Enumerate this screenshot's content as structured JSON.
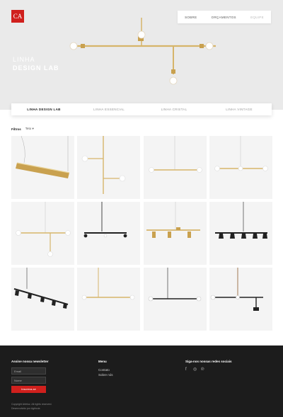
{
  "brand": {
    "logo_text": "CA",
    "accent": "#d0201d"
  },
  "nav": {
    "items": [
      "Sobre",
      "Orçamentos",
      "Equipe"
    ]
  },
  "hero": {
    "title_line1": "LINHA",
    "title_line2": "DESIGN LAB"
  },
  "tabs": [
    {
      "label": "Linha Design Lab",
      "active": true
    },
    {
      "label": "Linha Essencial",
      "active": false
    },
    {
      "label": "Linha Cristal",
      "active": false
    },
    {
      "label": "Linha Vintage",
      "active": false
    }
  ],
  "filters": {
    "label": "Filtros",
    "selected": "Teto"
  },
  "products": [
    {
      "icon": "gold-bar-pendant-icon"
    },
    {
      "icon": "gold-wall-lamp-icon"
    },
    {
      "icon": "gold-linear-pendant-icon"
    },
    {
      "icon": "gold-linear-pendant-icon"
    },
    {
      "icon": "gold-cross-pendant-icon"
    },
    {
      "icon": "black-bar-pendant-icon"
    },
    {
      "icon": "gold-spot-rail-icon"
    },
    {
      "icon": "black-spot-rail-icon"
    },
    {
      "icon": "black-track-spots-icon"
    },
    {
      "icon": "gold-line-pendant-icon"
    },
    {
      "icon": "black-line-pendant-icon"
    },
    {
      "icon": "black-cross-pendant-icon"
    }
  ],
  "footer": {
    "newsletter_title": "Assine nossa newsletter",
    "email_placeholder": "Email",
    "name_placeholder": "Nome",
    "subscribe_label": "Inscreva-se",
    "menu_title": "Menu",
    "menu_items": [
      "Contato",
      "Sobre nós"
    ],
    "social_title": "Siga-nos nossas redes sociais",
    "social_icons": [
      "facebook-icon",
      "instagram-icon",
      "pinterest-icon"
    ],
    "copyright_line1": "Copyright Arteluz. All rights reserved.",
    "copyright_line2": "Desenvolvido por Agência"
  }
}
